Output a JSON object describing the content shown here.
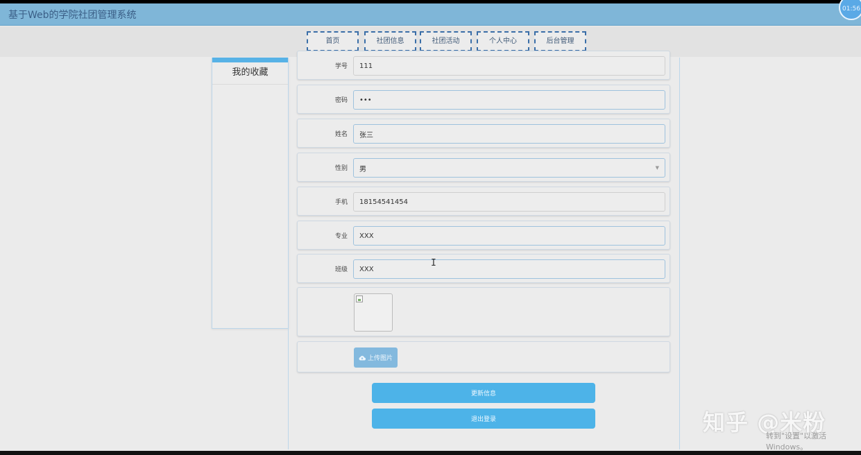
{
  "app": {
    "title": "基于Web的学院社团管理系统",
    "clock": "01:56"
  },
  "nav": {
    "items": [
      "首页",
      "社团信息",
      "社团活动",
      "个人中心",
      "后台管理"
    ]
  },
  "sidebar": {
    "items": [
      "我的收藏"
    ]
  },
  "form": {
    "student_id": {
      "label": "学号",
      "value": "111"
    },
    "password": {
      "label": "密码",
      "value": "•••"
    },
    "name": {
      "label": "姓名",
      "value": "张三"
    },
    "gender": {
      "label": "性别",
      "value": "男"
    },
    "phone": {
      "label": "手机",
      "value": "18154541454"
    },
    "major": {
      "label": "专业",
      "value": "XXX"
    },
    "class": {
      "label": "班级",
      "value": "XXX"
    }
  },
  "upload": {
    "label": "上传图片",
    "icon": "cloud-upload-icon"
  },
  "actions": {
    "update": "更新信息",
    "logout": "退出登录"
  },
  "overlay": {
    "watermark": "知乎 @米粉",
    "activation": "转到\"设置\"以激活 Windows。"
  },
  "colors": {
    "header": "#7fb6d8",
    "accent": "#4db3e8",
    "upload": "#83b9de"
  }
}
